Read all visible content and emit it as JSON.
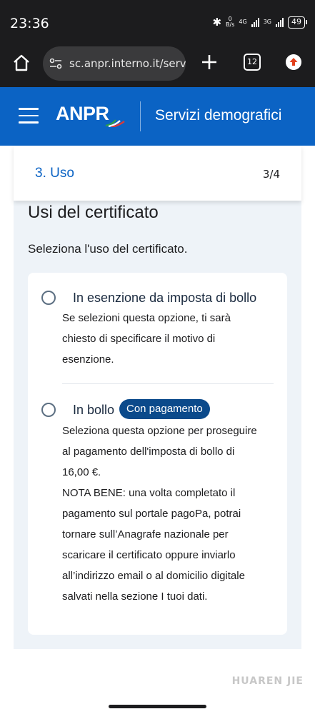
{
  "status_bar": {
    "time": "23:36",
    "net_speed_value": "0",
    "net_speed_unit": "B/s",
    "net_type_1": "4G",
    "net_type_2": "3G",
    "battery": "49"
  },
  "browser": {
    "url": "sc.anpr.interno.it/serv",
    "tab_count": "12"
  },
  "header": {
    "logo": "ANPR",
    "title": "Servizi demografici"
  },
  "step": {
    "label": "3. Uso",
    "count": "3/4"
  },
  "section": {
    "title": "Usi del certificato",
    "subtitle": "Seleziona l'uso del certificato."
  },
  "options": [
    {
      "label": "In esenzione da imposta di bollo",
      "desc_lines": [
        "Se selezioni questa opzione, ti sarà",
        "chiesto di specificare il motivo di",
        "esenzione."
      ]
    },
    {
      "label": "In bollo",
      "badge": "Con pagamento",
      "desc_lines": [
        "Seleziona questa opzione per proseguire",
        "al pagamento dell'imposta di bollo di",
        "16,00 €.",
        "NOTA BENE: una volta completato il",
        "pagamento sul portale pagoPa, potrai",
        "tornare sull’Anagrafe nazionale per",
        "scaricare il certificato oppure inviarlo",
        "all’indirizzo email o al domicilio digitale",
        "salvati nella sezione I tuoi dati."
      ]
    }
  ],
  "watermark": "HUAREN JIE",
  "colors": {
    "brand_blue": "#0b63c4",
    "badge_blue": "#0b4a8b",
    "content_bg": "#eef3f8"
  }
}
